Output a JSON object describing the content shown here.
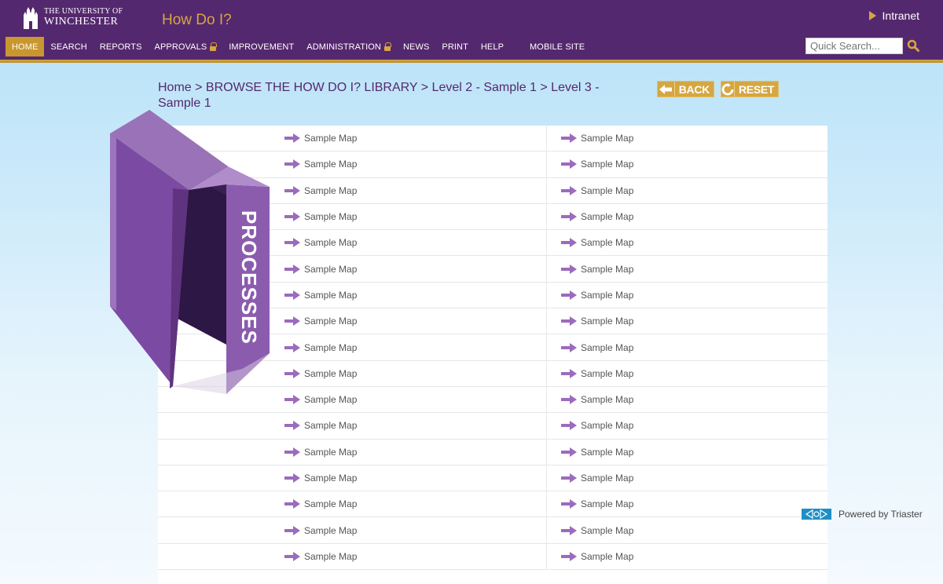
{
  "header": {
    "logo_line1": "THE UNIVERSITY OF",
    "logo_line2": "WINCHESTER",
    "app_title": "How Do I?",
    "intranet_label": "Intranet",
    "search_placeholder": "Quick Search...",
    "nav": [
      {
        "label": "HOME",
        "active": true,
        "locked": false
      },
      {
        "label": "SEARCH",
        "active": false,
        "locked": false
      },
      {
        "label": "REPORTS",
        "active": false,
        "locked": false
      },
      {
        "label": "APPROVALS",
        "active": false,
        "locked": true
      },
      {
        "label": "IMPROVEMENT",
        "active": false,
        "locked": false
      },
      {
        "label": "ADMINISTRATION",
        "active": false,
        "locked": true
      },
      {
        "label": "NEWS",
        "active": false,
        "locked": false
      },
      {
        "label": "PRINT",
        "active": false,
        "locked": false
      },
      {
        "label": "HELP",
        "active": false,
        "locked": false
      },
      {
        "label": "MOBILE SITE",
        "active": false,
        "locked": false
      }
    ]
  },
  "breadcrumb": "Home > BROWSE THE HOW DO I? LIBRARY > Level 2 - Sample 1 > Level 3 - Sample 1",
  "buttons": {
    "back": "BACK",
    "reset": "RESET"
  },
  "box_label": "PROCESSES",
  "list": {
    "left": [
      "Sample Map",
      "Sample Map",
      "Sample Map",
      "Sample Map",
      "Sample Map",
      "Sample Map",
      "Sample Map",
      "Sample Map",
      "Sample Map",
      "Sample Map",
      "Sample Map",
      "Sample Map",
      "Sample Map",
      "Sample Map",
      "Sample Map",
      "Sample Map",
      "Sample Map"
    ],
    "right": [
      "Sample Map",
      "Sample Map",
      "Sample Map",
      "Sample Map",
      "Sample Map",
      "Sample Map",
      "Sample Map",
      "Sample Map",
      "Sample Map",
      "Sample Map",
      "Sample Map",
      "Sample Map",
      "Sample Map",
      "Sample Map",
      "Sample Map",
      "Sample Map",
      "Sample Map"
    ]
  },
  "footer": {
    "powered_by": "Powered by Triaster"
  },
  "colors": {
    "brand_purple": "#54286e",
    "accent_gold": "#d6a640",
    "arrow_purple": "#9b6bbd"
  }
}
